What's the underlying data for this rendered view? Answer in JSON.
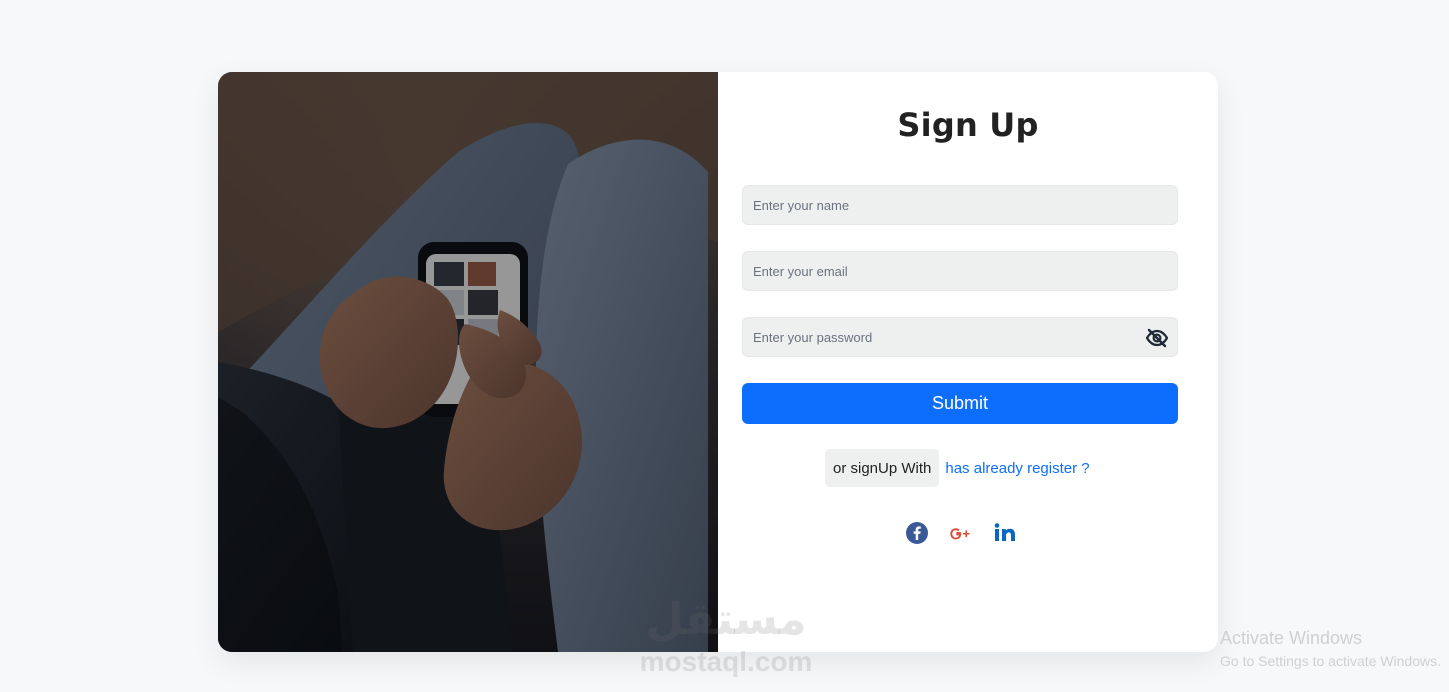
{
  "page": {
    "title": "Sign Up"
  },
  "form": {
    "name_placeholder": "Enter your name",
    "email_placeholder": "Enter your email",
    "password_placeholder": "Enter your password",
    "submit_label": "Submit",
    "alt_text": "or signUp With",
    "alt_link": "has already register ?"
  },
  "icons": {
    "visibility": "eye-off-icon",
    "facebook": "facebook-icon",
    "google_plus": "google-plus-icon",
    "linkedin": "linkedin-icon"
  },
  "colors": {
    "primary": "#0d6efd",
    "facebook": "#3b5998",
    "google_plus": "#dd4b39",
    "linkedin": "#0a66c2",
    "field_bg": "#eeefef"
  },
  "overlay": {
    "watermark_arabic": "مستقل",
    "watermark_latin": "mostaql.com",
    "activate_title": "Activate Windows",
    "activate_subtitle": "Go to Settings to activate Windows."
  }
}
